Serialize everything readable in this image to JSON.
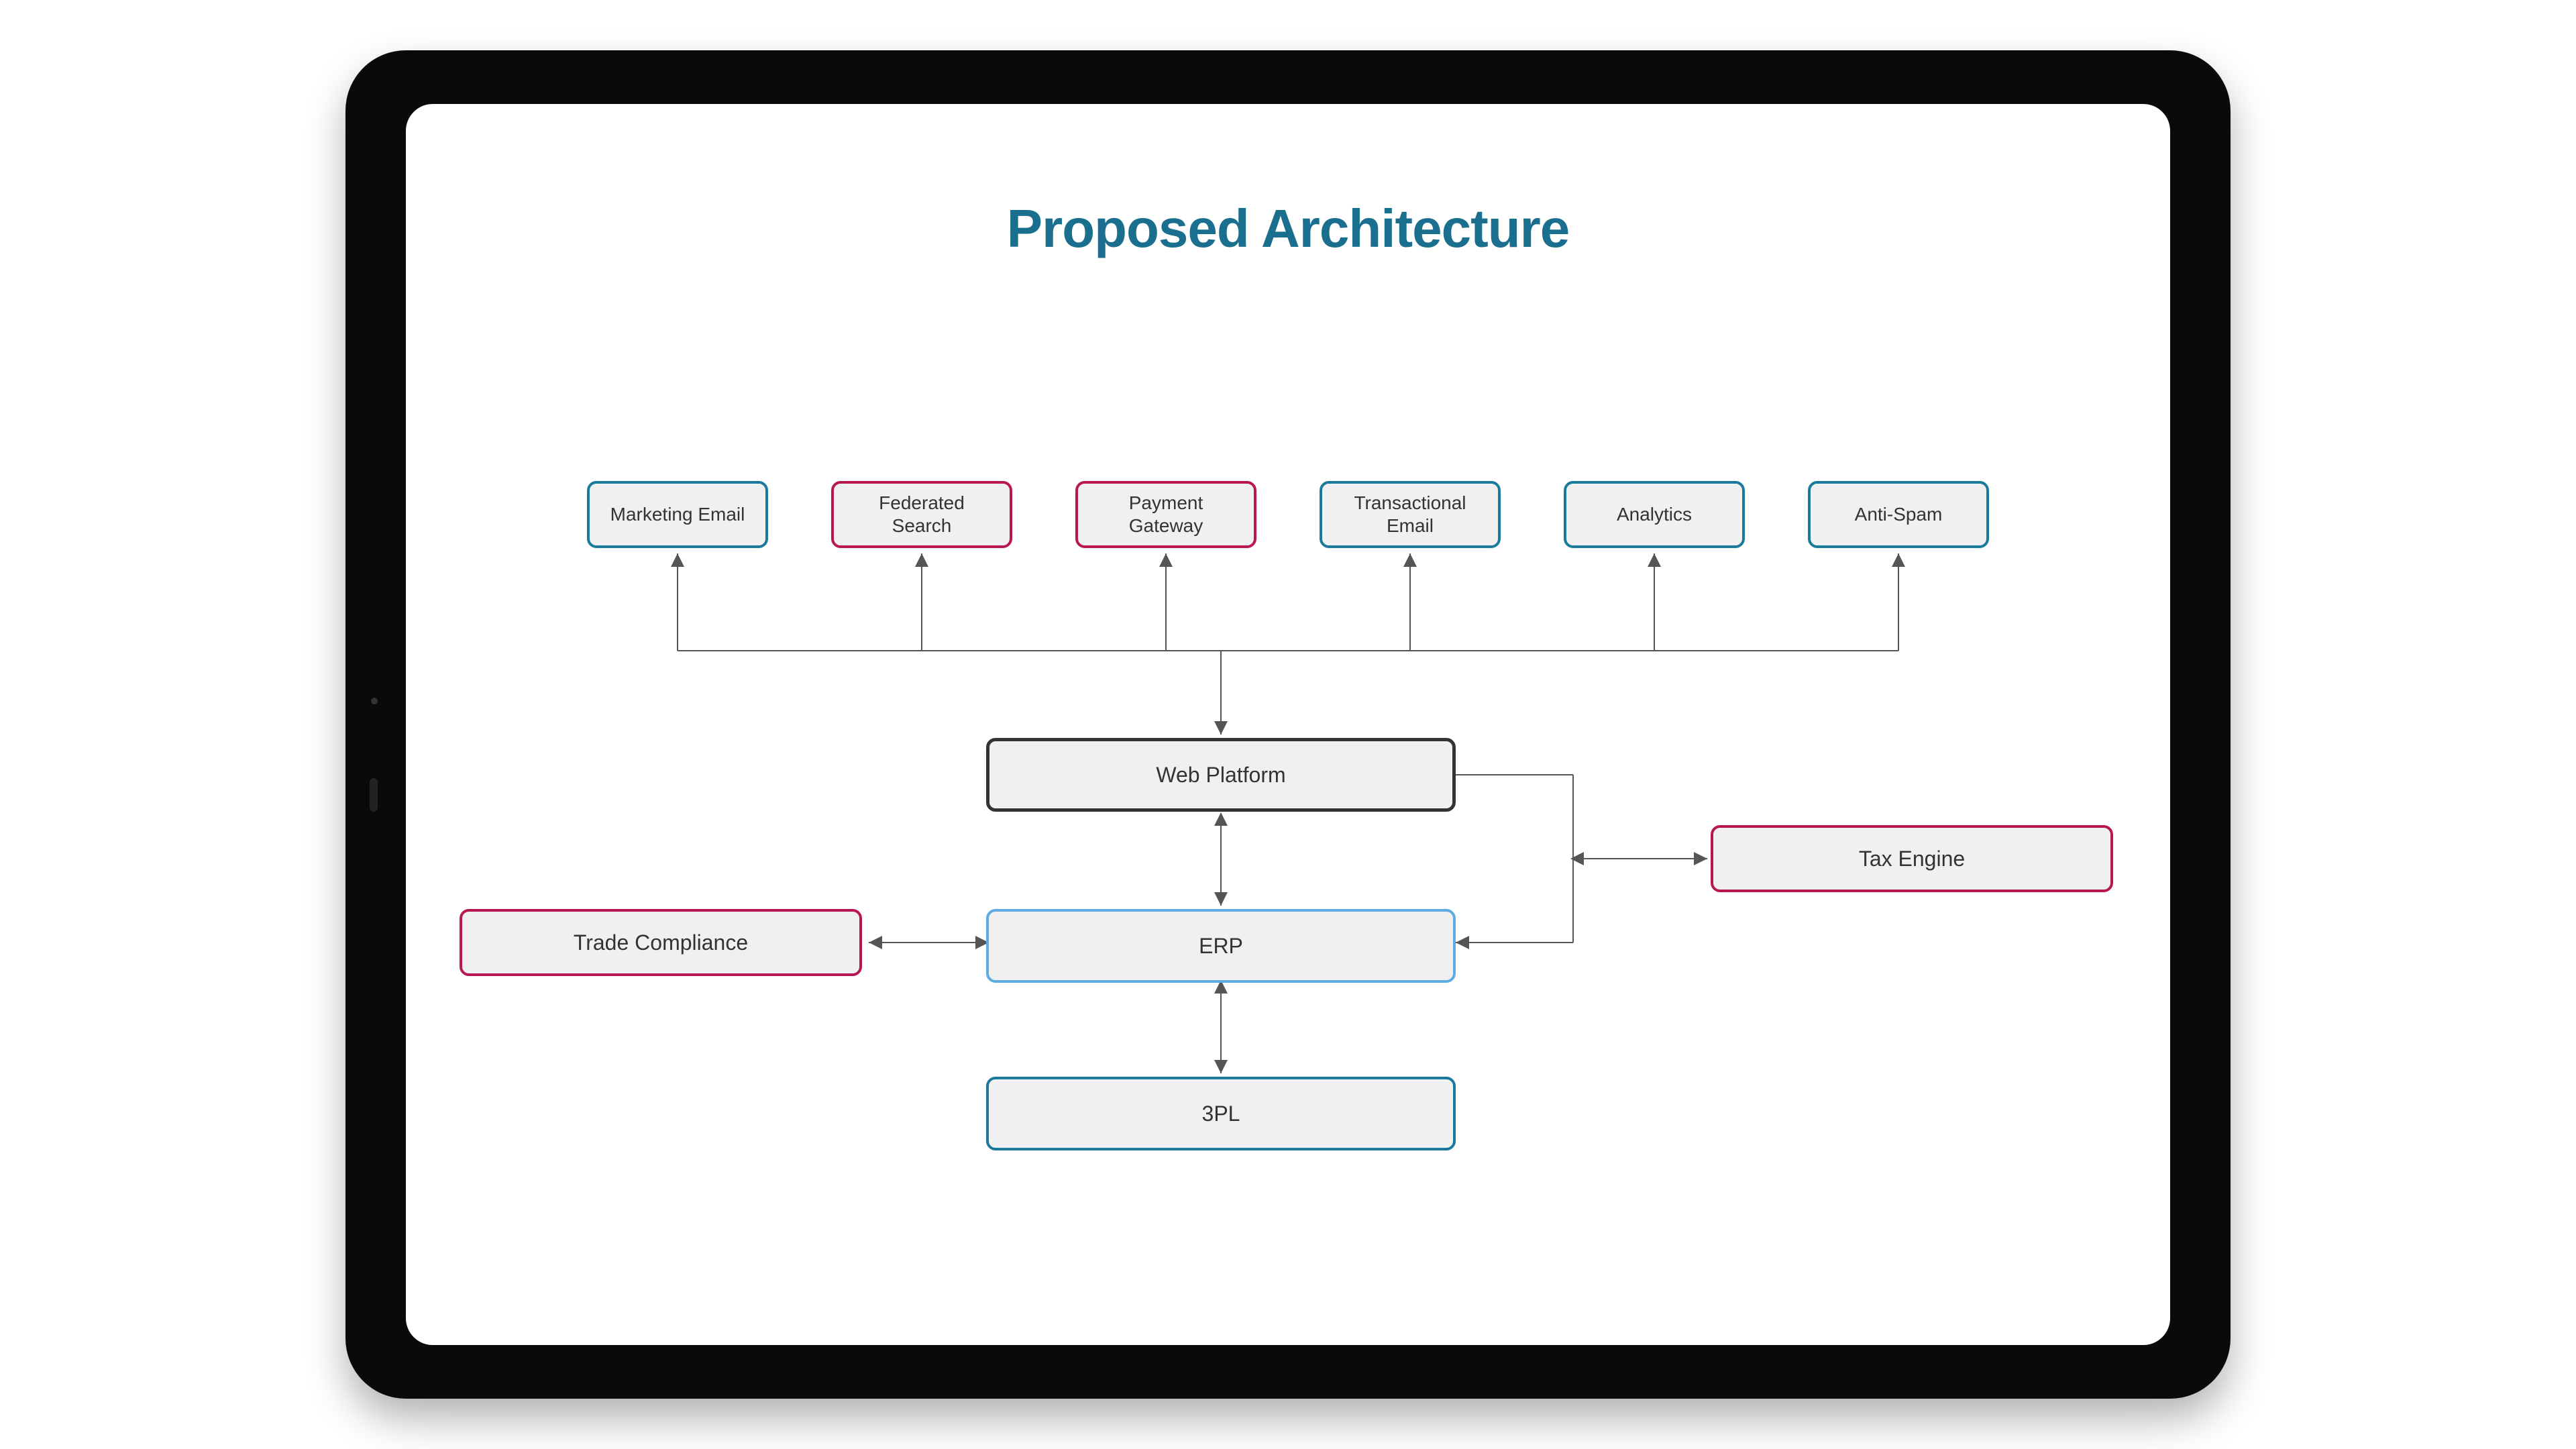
{
  "title": "Proposed Architecture",
  "top_row": [
    {
      "label": "Marketing Email",
      "color": "teal"
    },
    {
      "label": "Federated Search",
      "color": "magenta"
    },
    {
      "label": "Payment Gateway",
      "color": "magenta"
    },
    {
      "label": "Transactional Email",
      "color": "teal"
    },
    {
      "label": "Analytics",
      "color": "teal"
    },
    {
      "label": "Anti-Spam",
      "color": "teal"
    }
  ],
  "web_platform": "Web Platform",
  "erp": "ERP",
  "three_pl": "3PL",
  "tax_engine": "Tax Engine",
  "trade_compliance": "Trade Compliance",
  "colors": {
    "teal": "#1a7a9c",
    "magenta": "#b91754",
    "dark": "#333333",
    "light_blue": "#5dade2",
    "box_bg": "#f0f0f0",
    "title": "#1a6e8e"
  }
}
